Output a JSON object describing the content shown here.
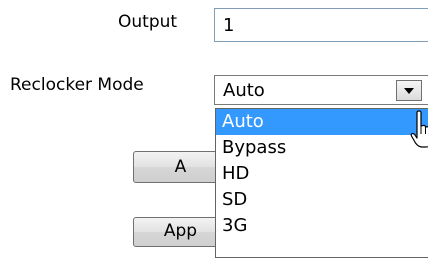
{
  "form": {
    "output_label": "Output",
    "output_value": "1",
    "reclocker_label": "Reclocker Mode",
    "reclocker_value": "Auto"
  },
  "dropdown": {
    "options": [
      "Auto",
      "Bypass",
      "HD",
      "SD",
      "3G"
    ],
    "highlighted": "Auto"
  },
  "buttons": {
    "button1_label": "A",
    "button2_label": "App"
  },
  "icons": {
    "dropdown_arrow": "chevron-down-icon",
    "cursor": "hand-pointer-icon"
  },
  "colors": {
    "highlight": "#3399ff",
    "highlight_text": "#ffffff"
  }
}
